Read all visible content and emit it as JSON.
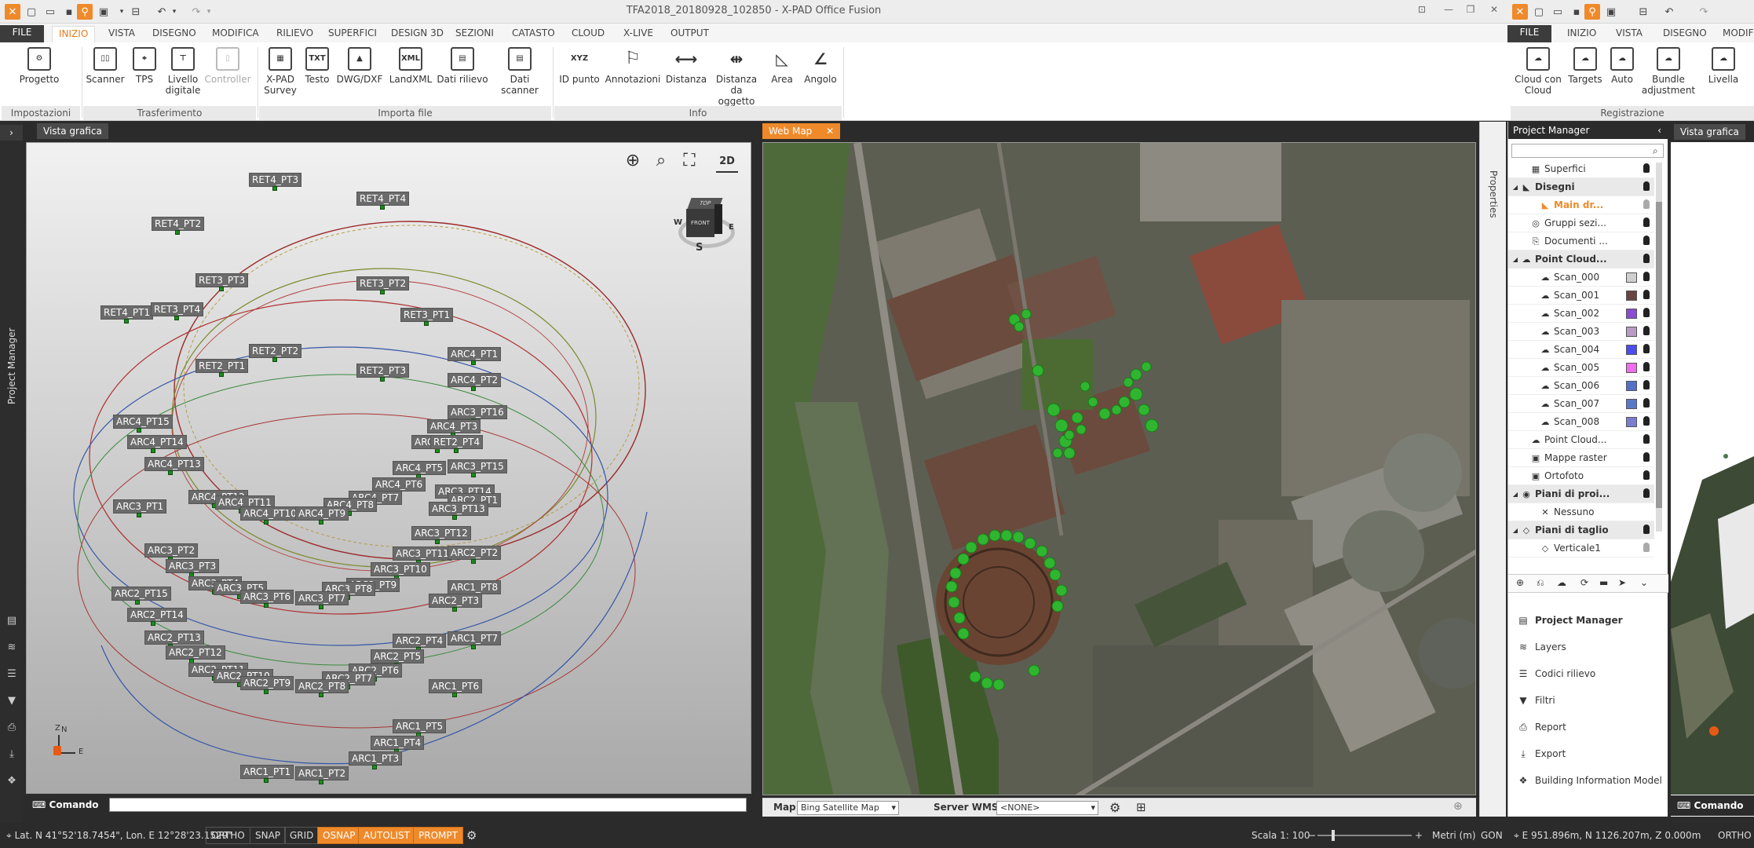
{
  "app": {
    "title": "TFA2018_20180928_102850 - X-PAD Office Fusion",
    "accent_color": "#ef8a2b"
  },
  "tabs": [
    "FILE",
    "INIZIO",
    "VISTA",
    "DISEGNO",
    "MODIFICA",
    "RILIEVO",
    "SUPERFICI",
    "DESIGN 3D",
    "SEZIONI",
    "CATASTO",
    "CLOUD",
    "X-LIVE",
    "OUTPUT"
  ],
  "tabs_right": [
    "FILE",
    "INIZIO",
    "VISTA",
    "DISEGNO",
    "MODIFIC"
  ],
  "ribbon": {
    "buttons": {
      "progetto": "Progetto",
      "scanner": "Scanner",
      "tps": "TPS",
      "livello_digitale": [
        "Livello",
        "digitale"
      ],
      "controller": "Controller",
      "xpad_survey": [
        "X-PAD",
        "Survey"
      ],
      "testo": "Testo",
      "dwg": "DWG/DXF",
      "landxml": "LandXML",
      "dati_rilievo": "Dati rilievo",
      "dati_scanner": "Dati scanner",
      "id_punto": "ID punto",
      "annotazioni": "Annotazioni",
      "distanza": "Distanza",
      "distanza_oggetto": [
        "Distanza",
        "da oggetto"
      ],
      "area": "Area",
      "angolo": "Angolo",
      "cloud_con_cloud": [
        "Cloud con",
        "Cloud"
      ],
      "targets": "Targets",
      "auto": "Auto",
      "bundle": [
        "Bundle",
        "adjustment"
      ],
      "livella": "Livella"
    },
    "icon_text": {
      "txt": "TXT",
      "xyz": "XYZ",
      "xml": "XML"
    },
    "groups": {
      "impostazioni": "Impostazioni",
      "trasferimento": "Trasferimento",
      "importa": "Importa file",
      "info": "Info",
      "registrazione": "Registrazione"
    }
  },
  "left_strip": {
    "project_manager": "Project Manager"
  },
  "view3d": {
    "tab": "Vista grafica",
    "view_toggle": "2D",
    "cube": {
      "top": "TOP",
      "front": "FRONT",
      "w": "W",
      "e": "E",
      "s": "S"
    },
    "axes": {
      "z": "Z",
      "n": "N",
      "e": "E"
    },
    "labels": [
      {
        "id": "ret4_pt3",
        "text": "RET4_PT3"
      },
      {
        "id": "ret4_pt4",
        "text": "RET4_PT4"
      },
      {
        "id": "ret4_pt2",
        "text": "RET4_PT2"
      },
      {
        "id": "ret3_pt3",
        "text": "RET3_PT3"
      },
      {
        "id": "ret3_pt2",
        "text": "RET3_PT2"
      },
      {
        "id": "ret4_pt1",
        "text": "RET4_PT1"
      },
      {
        "id": "ret3_pt4",
        "text": "RET3_PT4"
      },
      {
        "id": "ret3_pt1",
        "text": "RET3_PT1"
      },
      {
        "id": "ret2_pt2",
        "text": "RET2_PT2"
      },
      {
        "id": "arc4_pt1",
        "text": "ARC4_PT1"
      },
      {
        "id": "ret2_pt1",
        "text": "RET2_PT1"
      },
      {
        "id": "ret2_pt3",
        "text": "RET2_PT3"
      },
      {
        "id": "arc4_pt2",
        "text": "ARC4_PT2"
      },
      {
        "id": "arc3_pt16",
        "text": "ARC3_PT16"
      },
      {
        "id": "arc4_pt15",
        "text": "ARC4_PT15"
      },
      {
        "id": "arc4_pt3",
        "text": "ARC4_PT3"
      },
      {
        "id": "arc4_pt14",
        "text": "ARC4_PT14"
      },
      {
        "id": "arc4_",
        "text": "ARC4_"
      },
      {
        "id": "ret2_pt4",
        "text": "RET2_PT4"
      },
      {
        "id": "arc4_pt13",
        "text": "ARC4_PT13"
      },
      {
        "id": "arc4_pt5",
        "text": "ARC4_PT5"
      },
      {
        "id": "arc3_pt15",
        "text": "ARC3_PT15"
      },
      {
        "id": "arc4_pt6",
        "text": "ARC4_PT6"
      },
      {
        "id": "arc4_pt12",
        "text": "ARC4_PT12"
      },
      {
        "id": "arc4_pt11",
        "text": "ARC4_PT11"
      },
      {
        "id": "arc4_pt7",
        "text": "ARC4_PT7"
      },
      {
        "id": "arc3_pt14",
        "text": "ARC3_PT14"
      },
      {
        "id": "arc3_pt1",
        "text": "ARC3_PT1"
      },
      {
        "id": "arc4_pt8",
        "text": "ARC4_PT8"
      },
      {
        "id": "arc2_pt1",
        "text": "ARC2_PT1"
      },
      {
        "id": "arc4_pt10",
        "text": "ARC4_PT10"
      },
      {
        "id": "arc4_pt9",
        "text": "ARC4_PT9"
      },
      {
        "id": "arc3_pt13",
        "text": "ARC3_PT13"
      },
      {
        "id": "arc3_pt12",
        "text": "ARC3_PT12"
      },
      {
        "id": "arc3_pt2",
        "text": "ARC3_PT2"
      },
      {
        "id": "arc3_pt11",
        "text": "ARC3_PT11"
      },
      {
        "id": "arc2_pt2",
        "text": "ARC2_PT2"
      },
      {
        "id": "arc3_pt3",
        "text": "ARC3_PT3"
      },
      {
        "id": "arc3_pt10",
        "text": "ARC3_PT10"
      },
      {
        "id": "arc3_pt4",
        "text": "ARC3_PT4"
      },
      {
        "id": "arc3_pt9",
        "text": "ARC3_PT9"
      },
      {
        "id": "arc3_pt5",
        "text": "ARC3_PT5"
      },
      {
        "id": "arc3_pt8",
        "text": "ARC3_PT8"
      },
      {
        "id": "arc1_pt8",
        "text": "ARC1_PT8"
      },
      {
        "id": "arc2_pt15",
        "text": "ARC2_PT15"
      },
      {
        "id": "arc3_pt6",
        "text": "ARC3_PT6"
      },
      {
        "id": "arc3_pt7",
        "text": "ARC3_PT7"
      },
      {
        "id": "arc2_pt3",
        "text": "ARC2_PT3"
      },
      {
        "id": "arc2_pt14",
        "text": "ARC2_PT14"
      },
      {
        "id": "arc2_pt13",
        "text": "ARC2_PT13"
      },
      {
        "id": "arc2_pt4",
        "text": "ARC2_PT4"
      },
      {
        "id": "arc1_pt7",
        "text": "ARC1_PT7"
      },
      {
        "id": "arc2_pt12",
        "text": "ARC2_PT12"
      },
      {
        "id": "arc2_pt5",
        "text": "ARC2_PT5"
      },
      {
        "id": "arc2_pt11",
        "text": "ARC2_PT11"
      },
      {
        "id": "arc2_pt6",
        "text": "ARC2_PT6"
      },
      {
        "id": "arc2_pt10",
        "text": "ARC2_PT10"
      },
      {
        "id": "arc2_pt7",
        "text": "ARC2_PT7"
      },
      {
        "id": "arc2_pt9",
        "text": "ARC2_PT9"
      },
      {
        "id": "arc2_pt8",
        "text": "ARC2_PT8"
      },
      {
        "id": "arc1_pt6",
        "text": "ARC1_PT6"
      },
      {
        "id": "arc1_pt5",
        "text": "ARC1_PT5"
      },
      {
        "id": "arc1_pt4",
        "text": "ARC1_PT4"
      },
      {
        "id": "arc1_pt3",
        "text": "ARC1_PT3"
      },
      {
        "id": "arc1_pt1",
        "text": "ARC1_PT1"
      },
      {
        "id": "arc1_pt2",
        "text": "ARC1_PT2"
      }
    ],
    "command_label": "Comando",
    "command_value": ""
  },
  "webmap": {
    "tab": "Web Map",
    "map_label": "Map",
    "map_value": "Bing Satellite Map",
    "wms_label": "Server WMS",
    "wms_value": "<NONE>"
  },
  "properties_label": "Properties",
  "project_manager": {
    "title": "Project Manager",
    "search_value": "",
    "tree": [
      {
        "id": "superfici",
        "name": "Superfici",
        "indent": 1,
        "bold": false,
        "section": false,
        "icon": "grid-icon",
        "color": null
      },
      {
        "id": "disegni",
        "name": "Disegni",
        "indent": 0,
        "bold": true,
        "section": true,
        "icon": "drawing-icon",
        "color": null
      },
      {
        "id": "main_dr",
        "name": "Main dr...",
        "indent": 2,
        "bold": true,
        "section": false,
        "icon": "drawing-icon",
        "color": null,
        "highlight": "#ef8a2b"
      },
      {
        "id": "gruppi",
        "name": "Gruppi sezi...",
        "indent": 1,
        "bold": false,
        "section": false,
        "icon": "sections-icon",
        "color": null
      },
      {
        "id": "documenti",
        "name": "Documenti ...",
        "indent": 1,
        "bold": false,
        "section": false,
        "icon": "paperclip-icon",
        "color": null
      },
      {
        "id": "pointcloud1",
        "name": "Point Cloud...",
        "indent": 0,
        "bold": true,
        "section": true,
        "icon": "cloud-icon",
        "color": null
      },
      {
        "id": "scan_000",
        "name": "Scan_000",
        "indent": 2,
        "bold": false,
        "section": false,
        "icon": "cloud-icon",
        "color": "#cfcfcf"
      },
      {
        "id": "scan_001",
        "name": "Scan_001",
        "indent": 2,
        "bold": false,
        "section": false,
        "icon": "cloud-icon",
        "color": "#6b4444"
      },
      {
        "id": "scan_002",
        "name": "Scan_002",
        "indent": 2,
        "bold": false,
        "section": false,
        "icon": "cloud-icon",
        "color": "#8a4cd1"
      },
      {
        "id": "scan_003",
        "name": "Scan_003",
        "indent": 2,
        "bold": false,
        "section": false,
        "icon": "cloud-icon",
        "color": "#b89cc4"
      },
      {
        "id": "scan_004",
        "name": "Scan_004",
        "indent": 2,
        "bold": false,
        "section": false,
        "icon": "cloud-icon",
        "color": "#4c4cf0"
      },
      {
        "id": "scan_005",
        "name": "Scan_005",
        "indent": 2,
        "bold": false,
        "section": false,
        "icon": "cloud-icon",
        "color": "#f06cf0"
      },
      {
        "id": "scan_006",
        "name": "Scan_006",
        "indent": 2,
        "bold": false,
        "section": false,
        "icon": "cloud-icon",
        "color": "#5470c8"
      },
      {
        "id": "scan_007",
        "name": "Scan_007",
        "indent": 2,
        "bold": false,
        "section": false,
        "icon": "cloud-icon",
        "color": "#5a78c8"
      },
      {
        "id": "scan_008",
        "name": "Scan_008",
        "indent": 2,
        "bold": false,
        "section": false,
        "icon": "cloud-icon",
        "color": "#7b7ed0"
      },
      {
        "id": "pointcloud2",
        "name": "Point Cloud...",
        "indent": 1,
        "bold": false,
        "section": false,
        "icon": "cloud-icon",
        "color": null
      },
      {
        "id": "mappe",
        "name": "Mappe raster",
        "indent": 1,
        "bold": false,
        "section": false,
        "icon": "image-icon",
        "color": null
      },
      {
        "id": "ortofoto",
        "name": "Ortofoto",
        "indent": 1,
        "bold": false,
        "section": false,
        "icon": "image-icon",
        "color": null
      },
      {
        "id": "piani_proi",
        "name": "Piani di proi...",
        "indent": 0,
        "bold": true,
        "section": true,
        "icon": "eye-icon",
        "color": null
      },
      {
        "id": "nessuno",
        "name": "Nessuno",
        "indent": 2,
        "bold": false,
        "section": false,
        "icon": "x-icon",
        "color": null
      },
      {
        "id": "piani_taglio",
        "name": "Piani di taglio",
        "indent": 0,
        "bold": true,
        "section": true,
        "icon": "plane-icon",
        "color": null
      },
      {
        "id": "verticale1",
        "name": "Verticale1",
        "indent": 2,
        "bold": false,
        "section": false,
        "icon": "plane-icon",
        "color": null
      }
    ],
    "nav": [
      {
        "id": "pm",
        "label": "Project Manager",
        "bold": true,
        "icon": "list-icon"
      },
      {
        "id": "layers",
        "label": "Layers",
        "bold": false,
        "icon": "layers-icon"
      },
      {
        "id": "codici",
        "label": "Codici rilievo",
        "bold": false,
        "icon": "codes-icon"
      },
      {
        "id": "filtri",
        "label": "Filtri",
        "bold": false,
        "icon": "filter-icon"
      },
      {
        "id": "report",
        "label": "Report",
        "bold": false,
        "icon": "printer-icon"
      },
      {
        "id": "export",
        "label": "Export",
        "bold": false,
        "icon": "export-icon"
      },
      {
        "id": "bim",
        "label": "Building Information Model",
        "bold": false,
        "icon": "bim-icon"
      }
    ]
  },
  "right_view": {
    "tab": "Vista grafica",
    "command_label": "Comando"
  },
  "status": {
    "coords_latlon": "Lat. N 41°52'18.7454\", Lon. E 12°28'23.1529\"",
    "buttons": [
      {
        "id": "ortho",
        "label": "ORTHO",
        "on": false
      },
      {
        "id": "snap",
        "label": "SNAP",
        "on": false
      },
      {
        "id": "grid",
        "label": "GRID",
        "on": false
      },
      {
        "id": "osnap",
        "label": "OSNAP",
        "on": true
      },
      {
        "id": "autolist",
        "label": "AUTOLIST",
        "on": true
      },
      {
        "id": "prompt",
        "label": "PROMPT",
        "on": true
      }
    ],
    "scale": "Scala 1: 100",
    "units": "Metri (m)",
    "angle_unit": "GON",
    "coords_enz": "E 951.896m, N 1126.207m, Z 0.000m",
    "ortho_right": "ORTHO"
  }
}
